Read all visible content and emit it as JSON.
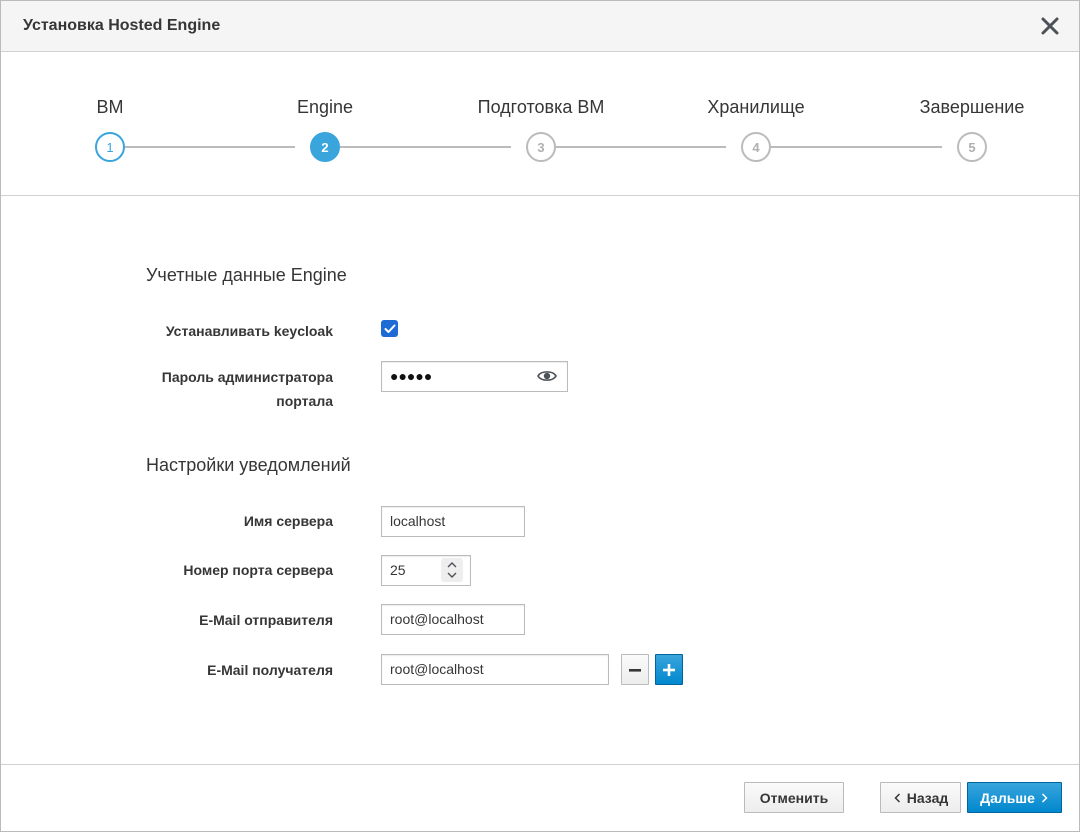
{
  "dialog": {
    "title": "Установка Hosted Engine",
    "close_icon": "close-icon"
  },
  "wizard": {
    "steps": [
      {
        "label": "ВМ",
        "number": "1",
        "state": "done"
      },
      {
        "label": "Engine",
        "number": "2",
        "state": "active"
      },
      {
        "label": "Подготовка ВМ",
        "number": "3",
        "state": "pending"
      },
      {
        "label": "Хранилище",
        "number": "4",
        "state": "pending"
      },
      {
        "label": "Завершение",
        "number": "5",
        "state": "pending"
      }
    ],
    "colors": {
      "accent": "#39a5dc",
      "inactive": "#bbbbbb"
    }
  },
  "engine_credentials": {
    "title": "Учетные данные Engine",
    "keycloak_label": "Устанавливать keycloak",
    "keycloak_checked": true,
    "admin_password_label_line1": "Пароль администратора",
    "admin_password_label_line2": "портала",
    "admin_password_value": "●●●●●",
    "eye_icon": "eye-icon"
  },
  "notifications": {
    "title": "Настройки уведомлений",
    "server_name_label": "Имя сервера",
    "server_name_value": "localhost",
    "server_port_label": "Номер порта сервера",
    "server_port_value": "25",
    "sender_email_label": "E-Mail отправителя",
    "sender_email_value": "root@localhost",
    "recipient_email_label": "E-Mail получателя",
    "recipient_email_value": "root@localhost",
    "remove_label": "−",
    "add_label": "+"
  },
  "footer": {
    "cancel_label": "Отменить",
    "back_label": "Назад",
    "next_label": "Дальше"
  }
}
